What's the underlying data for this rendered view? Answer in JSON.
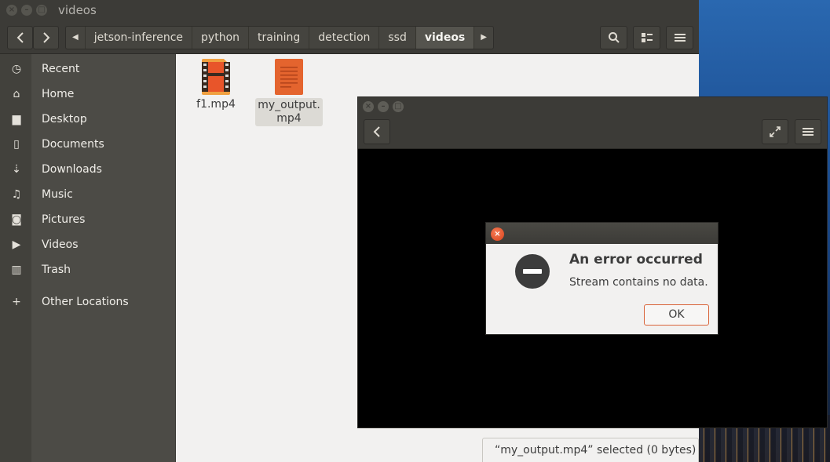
{
  "file_manager": {
    "title": "videos",
    "breadcrumbs": [
      "jetson-inference",
      "python",
      "training",
      "detection",
      "ssd",
      "videos"
    ],
    "sidebar": {
      "items": [
        {
          "label": "Recent",
          "icon": "clock-icon"
        },
        {
          "label": "Home",
          "icon": "home-icon"
        },
        {
          "label": "Desktop",
          "icon": "folder-icon"
        },
        {
          "label": "Documents",
          "icon": "document-icon"
        },
        {
          "label": "Downloads",
          "icon": "download-icon"
        },
        {
          "label": "Music",
          "icon": "music-icon"
        },
        {
          "label": "Pictures",
          "icon": "camera-icon"
        },
        {
          "label": "Videos",
          "icon": "video-icon"
        },
        {
          "label": "Trash",
          "icon": "trash-icon"
        },
        {
          "label": "Other Locations",
          "icon": "plus-icon"
        }
      ]
    },
    "files": [
      {
        "name": "f1.mp4",
        "type": "video"
      },
      {
        "name": "my_output.\nmp4",
        "type": "document",
        "selected": true
      }
    ],
    "status": "“my_output.mp4” selected  (0 bytes)"
  },
  "dialog": {
    "heading": "An error occurred",
    "message": "Stream contains no data.",
    "ok_label": "OK"
  },
  "colors": {
    "accent": "#e95420",
    "titlebar": "#3c3b37",
    "sidebar": "#4c4b46"
  }
}
